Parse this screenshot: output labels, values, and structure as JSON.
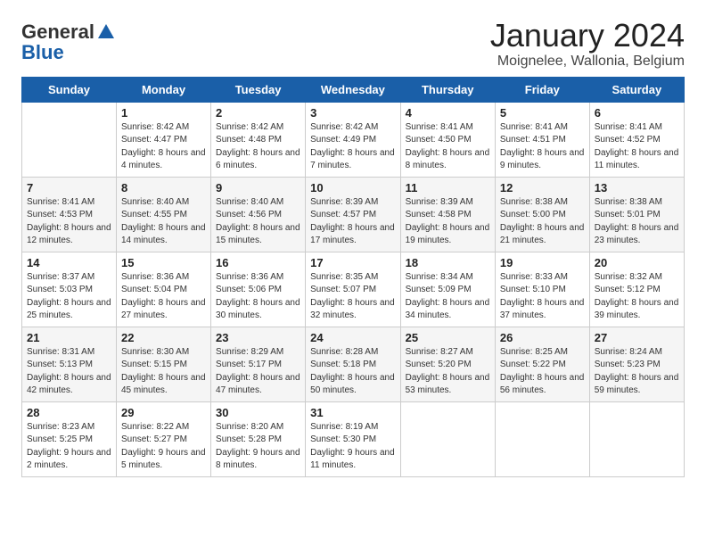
{
  "header": {
    "logo_general": "General",
    "logo_blue": "Blue",
    "month_title": "January 2024",
    "location": "Moignelee, Wallonia, Belgium"
  },
  "days_of_week": [
    "Sunday",
    "Monday",
    "Tuesday",
    "Wednesday",
    "Thursday",
    "Friday",
    "Saturday"
  ],
  "weeks": [
    [
      {
        "day": "",
        "info": ""
      },
      {
        "day": "1",
        "info": "Sunrise: 8:42 AM\nSunset: 4:47 PM\nDaylight: 8 hours\nand 4 minutes."
      },
      {
        "day": "2",
        "info": "Sunrise: 8:42 AM\nSunset: 4:48 PM\nDaylight: 8 hours\nand 6 minutes."
      },
      {
        "day": "3",
        "info": "Sunrise: 8:42 AM\nSunset: 4:49 PM\nDaylight: 8 hours\nand 7 minutes."
      },
      {
        "day": "4",
        "info": "Sunrise: 8:41 AM\nSunset: 4:50 PM\nDaylight: 8 hours\nand 8 minutes."
      },
      {
        "day": "5",
        "info": "Sunrise: 8:41 AM\nSunset: 4:51 PM\nDaylight: 8 hours\nand 9 minutes."
      },
      {
        "day": "6",
        "info": "Sunrise: 8:41 AM\nSunset: 4:52 PM\nDaylight: 8 hours\nand 11 minutes."
      }
    ],
    [
      {
        "day": "7",
        "info": "Sunrise: 8:41 AM\nSunset: 4:53 PM\nDaylight: 8 hours\nand 12 minutes."
      },
      {
        "day": "8",
        "info": "Sunrise: 8:40 AM\nSunset: 4:55 PM\nDaylight: 8 hours\nand 14 minutes."
      },
      {
        "day": "9",
        "info": "Sunrise: 8:40 AM\nSunset: 4:56 PM\nDaylight: 8 hours\nand 15 minutes."
      },
      {
        "day": "10",
        "info": "Sunrise: 8:39 AM\nSunset: 4:57 PM\nDaylight: 8 hours\nand 17 minutes."
      },
      {
        "day": "11",
        "info": "Sunrise: 8:39 AM\nSunset: 4:58 PM\nDaylight: 8 hours\nand 19 minutes."
      },
      {
        "day": "12",
        "info": "Sunrise: 8:38 AM\nSunset: 5:00 PM\nDaylight: 8 hours\nand 21 minutes."
      },
      {
        "day": "13",
        "info": "Sunrise: 8:38 AM\nSunset: 5:01 PM\nDaylight: 8 hours\nand 23 minutes."
      }
    ],
    [
      {
        "day": "14",
        "info": "Sunrise: 8:37 AM\nSunset: 5:03 PM\nDaylight: 8 hours\nand 25 minutes."
      },
      {
        "day": "15",
        "info": "Sunrise: 8:36 AM\nSunset: 5:04 PM\nDaylight: 8 hours\nand 27 minutes."
      },
      {
        "day": "16",
        "info": "Sunrise: 8:36 AM\nSunset: 5:06 PM\nDaylight: 8 hours\nand 30 minutes."
      },
      {
        "day": "17",
        "info": "Sunrise: 8:35 AM\nSunset: 5:07 PM\nDaylight: 8 hours\nand 32 minutes."
      },
      {
        "day": "18",
        "info": "Sunrise: 8:34 AM\nSunset: 5:09 PM\nDaylight: 8 hours\nand 34 minutes."
      },
      {
        "day": "19",
        "info": "Sunrise: 8:33 AM\nSunset: 5:10 PM\nDaylight: 8 hours\nand 37 minutes."
      },
      {
        "day": "20",
        "info": "Sunrise: 8:32 AM\nSunset: 5:12 PM\nDaylight: 8 hours\nand 39 minutes."
      }
    ],
    [
      {
        "day": "21",
        "info": "Sunrise: 8:31 AM\nSunset: 5:13 PM\nDaylight: 8 hours\nand 42 minutes."
      },
      {
        "day": "22",
        "info": "Sunrise: 8:30 AM\nSunset: 5:15 PM\nDaylight: 8 hours\nand 45 minutes."
      },
      {
        "day": "23",
        "info": "Sunrise: 8:29 AM\nSunset: 5:17 PM\nDaylight: 8 hours\nand 47 minutes."
      },
      {
        "day": "24",
        "info": "Sunrise: 8:28 AM\nSunset: 5:18 PM\nDaylight: 8 hours\nand 50 minutes."
      },
      {
        "day": "25",
        "info": "Sunrise: 8:27 AM\nSunset: 5:20 PM\nDaylight: 8 hours\nand 53 minutes."
      },
      {
        "day": "26",
        "info": "Sunrise: 8:25 AM\nSunset: 5:22 PM\nDaylight: 8 hours\nand 56 minutes."
      },
      {
        "day": "27",
        "info": "Sunrise: 8:24 AM\nSunset: 5:23 PM\nDaylight: 8 hours\nand 59 minutes."
      }
    ],
    [
      {
        "day": "28",
        "info": "Sunrise: 8:23 AM\nSunset: 5:25 PM\nDaylight: 9 hours\nand 2 minutes."
      },
      {
        "day": "29",
        "info": "Sunrise: 8:22 AM\nSunset: 5:27 PM\nDaylight: 9 hours\nand 5 minutes."
      },
      {
        "day": "30",
        "info": "Sunrise: 8:20 AM\nSunset: 5:28 PM\nDaylight: 9 hours\nand 8 minutes."
      },
      {
        "day": "31",
        "info": "Sunrise: 8:19 AM\nSunset: 5:30 PM\nDaylight: 9 hours\nand 11 minutes."
      },
      {
        "day": "",
        "info": ""
      },
      {
        "day": "",
        "info": ""
      },
      {
        "day": "",
        "info": ""
      }
    ]
  ]
}
